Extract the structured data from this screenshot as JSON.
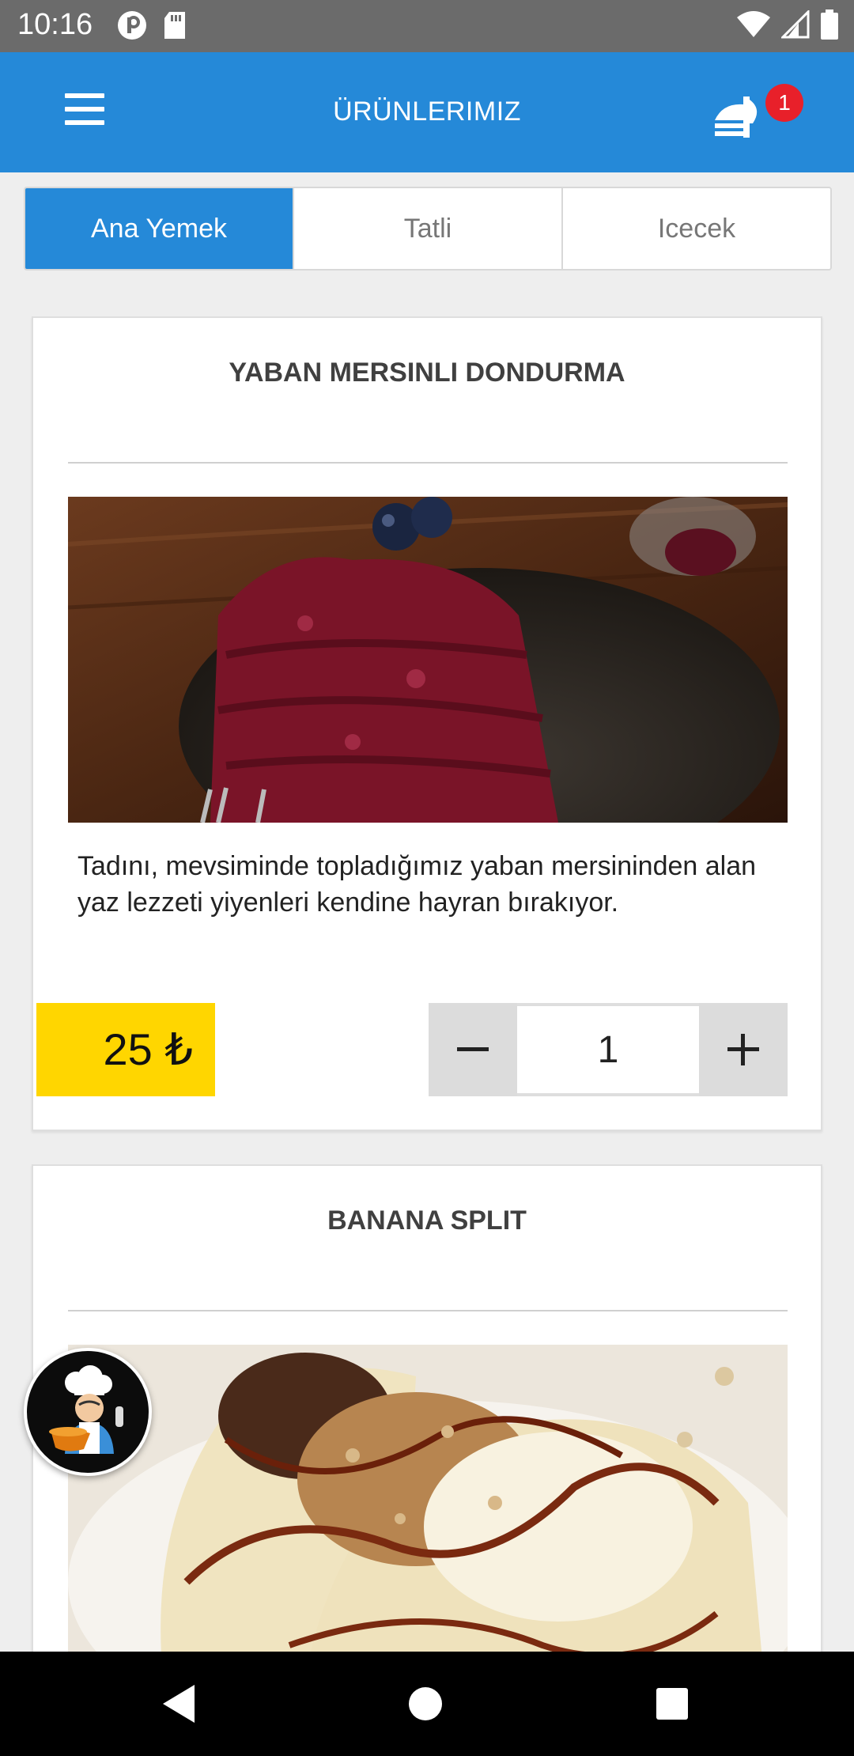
{
  "status_bar": {
    "time": "10:16",
    "left_icons": [
      "notification-p-icon",
      "sd-card-icon"
    ],
    "right_icons": [
      "wifi-icon",
      "signal-icon",
      "battery-icon"
    ]
  },
  "app_bar": {
    "title": "ÜRÜNLERIMIZ",
    "menu_icon": "hamburger-menu-icon",
    "cart_icon": "food-cart-icon",
    "cart_count": "1",
    "color": "#2589d8"
  },
  "tabs": [
    {
      "label": "Ana Yemek",
      "active": true
    },
    {
      "label": "Tatli",
      "active": false
    },
    {
      "label": "Icecek",
      "active": false
    }
  ],
  "products": [
    {
      "name": "YABAN MERSINLI DONDURMA",
      "description": "Tadını, mevsiminde topladığımız yaban mersininden alan yaz lezzeti yiyenleri kendine hayran bırakıyor.",
      "price": "25 ₺",
      "quantity": "1",
      "image": "blueberry-sorbet-image"
    },
    {
      "name": "BANANA SPLIT",
      "image": "banana-split-image"
    }
  ],
  "stepper": {
    "minus_icon": "minus-icon",
    "plus_icon": "plus-icon"
  },
  "fab": {
    "icon": "chef-icon"
  },
  "nav_bar": {
    "icons": [
      "back-icon",
      "home-icon",
      "recents-icon"
    ]
  },
  "colors": {
    "accent": "#2589d8",
    "price": "#ffd600",
    "badge": "#e8202a"
  }
}
